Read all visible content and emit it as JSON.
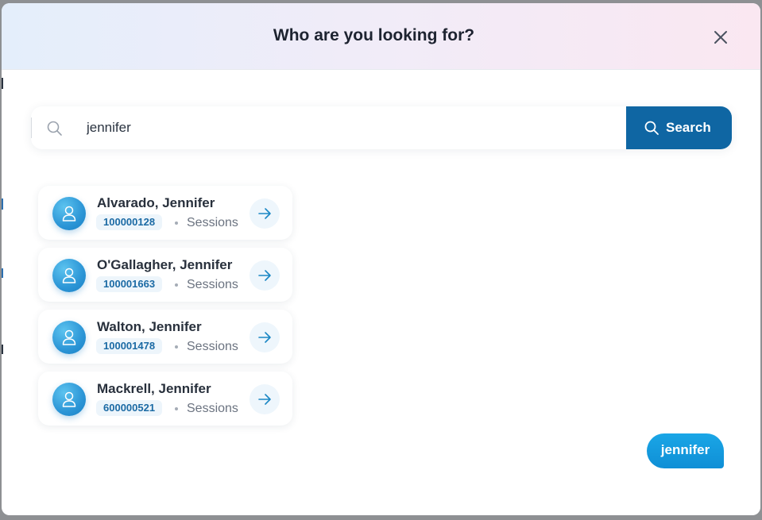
{
  "modal": {
    "title": "Who are you looking for?",
    "close_icon": "close-icon"
  },
  "search": {
    "value": "jennifer",
    "placeholder": "",
    "icon": "search-icon",
    "button_label": "Search"
  },
  "results": [
    {
      "name": "Alvarado, Jennifer",
      "id": "100000128",
      "link_label": "Sessions"
    },
    {
      "name": "O'Gallagher, Jennifer",
      "id": "100001663",
      "link_label": "Sessions"
    },
    {
      "name": "Walton, Jennifer",
      "id": "100001478",
      "link_label": "Sessions"
    },
    {
      "name": "Mackrell, Jennifer",
      "id": "600000521",
      "link_label": "Sessions"
    }
  ],
  "query_chip": {
    "label": "jennifer"
  },
  "colors": {
    "accent": "#0f66a3",
    "chip": "#1aa6e6",
    "badge_bg": "#edf5fb"
  }
}
